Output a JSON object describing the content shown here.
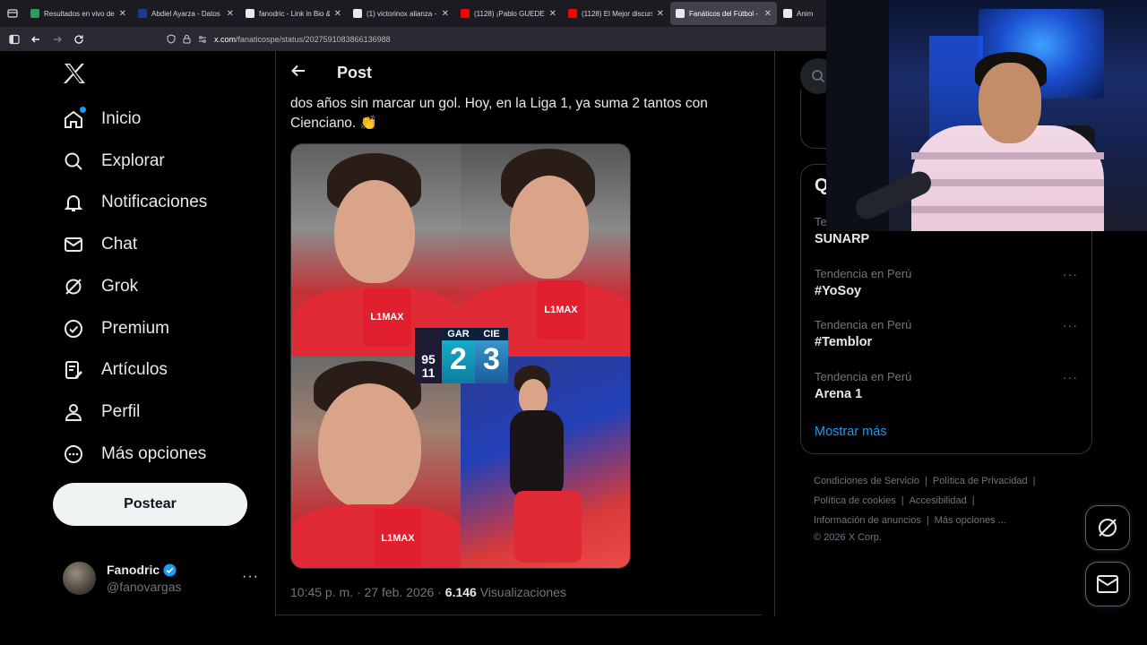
{
  "browser": {
    "tabs": [
      {
        "title": "Resultados en vivo de L",
        "color": "#2b9c5c",
        "active": false
      },
      {
        "title": "Abdiel Ayarza - Datos d",
        "color": "#1a3c8f",
        "active": false
      },
      {
        "title": "fanodric - Link in Bio &",
        "color": "#e7e9ea",
        "active": false
      },
      {
        "title": "(1) victorinox alianza - ",
        "color": "#e7e9ea",
        "active": false
      },
      {
        "title": "(1128) ¡Pablo GUEDE e",
        "color": "#ff0000",
        "active": false
      },
      {
        "title": "(1128) El Mejor discurs",
        "color": "#ff0000",
        "active": false
      },
      {
        "title": "Fanáticos del Fútbol - F",
        "color": "#e7e9ea",
        "active": true
      },
      {
        "title": "Anim",
        "color": "#e7e9ea",
        "active": false
      }
    ],
    "url_host": "x.com",
    "url_path": "/fanaticospe/status/2027591083866136988"
  },
  "nav": {
    "items": [
      {
        "label": "Inicio",
        "icon": "home-icon"
      },
      {
        "label": "Explorar",
        "icon": "search-icon"
      },
      {
        "label": "Notificaciones",
        "icon": "bell-icon"
      },
      {
        "label": "Chat",
        "icon": "mail-icon"
      },
      {
        "label": "Grok",
        "icon": "grok-icon"
      },
      {
        "label": "Premium",
        "icon": "verified-icon"
      },
      {
        "label": "Artículos",
        "icon": "article-icon"
      },
      {
        "label": "Perfil",
        "icon": "person-icon"
      },
      {
        "label": "Más opciones",
        "icon": "more-circle-icon"
      }
    ],
    "post_button": "Postear"
  },
  "account": {
    "name": "Fanodric",
    "handle": "@fanovargas",
    "more": "···"
  },
  "post": {
    "header_title": "Post",
    "text": "dos años sin marcar un gol. Hoy, en la Liga 1, ya suma 2 tantos con Cienciano. 👏",
    "media": {
      "sponsor": "L1MAX",
      "score_time_min": "95",
      "score_time_sec": "11",
      "home_abbr": "GAR",
      "home_goals": "2",
      "away_abbr": "CIE",
      "away_goals": "3"
    },
    "time": "10:45 p. m. · 27 feb. 2026 · ",
    "views": "6.146",
    "views_label": " Visualizaciones"
  },
  "trends": {
    "heading": "Q",
    "items": [
      {
        "context": "Te",
        "name": "SUNARP"
      },
      {
        "context": "Tendencia en Perú",
        "name": "#YoSoy"
      },
      {
        "context": "Tendencia en Perú",
        "name": "#Temblor"
      },
      {
        "context": "Tendencia en Perú",
        "name": "Arena 1"
      }
    ],
    "show_more": "Mostrar más"
  },
  "footer": {
    "terms": "Condiciones de Servicio",
    "privacy": "Política de Privacidad",
    "cookies": "Política de cookies",
    "accessibility": "Accesibilidad",
    "ads": "Información de anuncios",
    "more": "Más opciones ...",
    "copyright": "© 2026 X Corp."
  },
  "colors": {
    "accent": "#1d9bf0",
    "background": "#000000",
    "border": "#2f3336",
    "muted": "#71767b"
  }
}
